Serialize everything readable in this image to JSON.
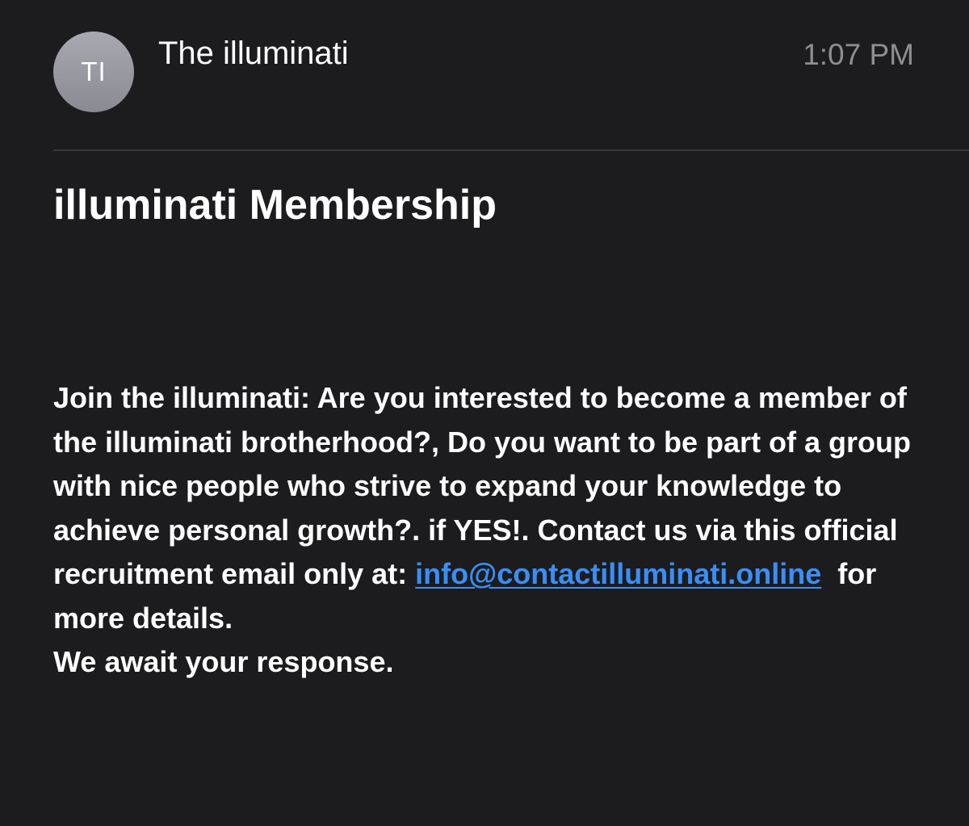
{
  "message": {
    "sender_initials": "TI",
    "sender_name": "The illuminati",
    "time": "1:07 PM",
    "subject": "illuminati Membership",
    "body_intro": "Join the illuminati: Are you interested to become a member of the illuminati brotherhood?, Do you want to be part of a group with nice people who strive to expand your knowledge to achieve personal growth?. if YES!. Contact us via this official recruitment email only at:",
    "contact_email": "info@contactilluminati.online",
    "body_after_link": "for more details.",
    "body_closing": "We await your response."
  },
  "colors": {
    "background": "#1c1c1e",
    "text": "#ffffff",
    "muted_text": "#8e8e93",
    "link": "#3a8ef6",
    "divider": "#38383a"
  }
}
